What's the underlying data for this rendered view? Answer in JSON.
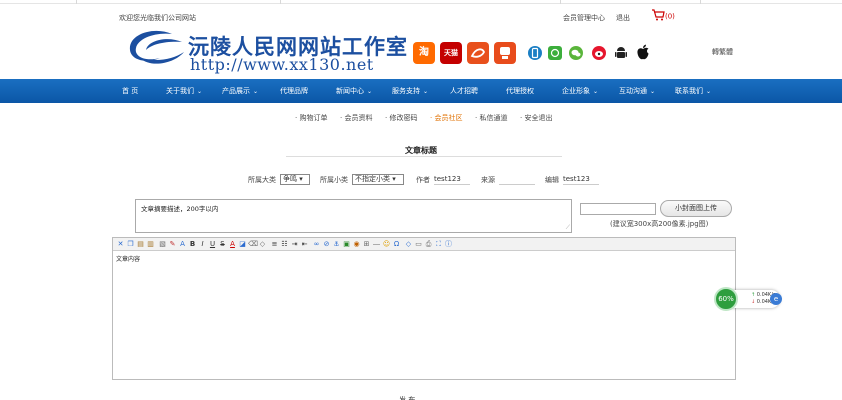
{
  "topbar": {
    "welcome": "欢迎您光临我们公司网站",
    "member_center": "会员管理中心",
    "logout": "退出",
    "cart_count": "(0)"
  },
  "logo": {
    "title": "沅陵人民网网站工作室",
    "url": "http://www.xx130.net"
  },
  "social_icons": [
    {
      "name": "taobao",
      "label": "淘",
      "color": "#ff6a00"
    },
    {
      "name": "tmall",
      "label": "天猫",
      "color": "#c40000"
    },
    {
      "name": "alipay",
      "label": "",
      "color": "#e8501c"
    },
    {
      "name": "weishop",
      "label": "",
      "color": "#e84c1c"
    }
  ],
  "right_icons": [
    {
      "name": "phone",
      "color": "#1b7fc4"
    },
    {
      "name": "message",
      "color": "#3cae3c"
    },
    {
      "name": "wechat",
      "color": "#5ab53b"
    },
    {
      "name": "weibo",
      "color": "#e6162d"
    },
    {
      "name": "android",
      "color": "#222222"
    },
    {
      "name": "apple",
      "color": "#222222"
    }
  ],
  "lang_toggle": "轉繁體",
  "nav": [
    {
      "label": "首 页",
      "caret": false
    },
    {
      "label": "关于我们",
      "caret": true
    },
    {
      "label": "产品展示",
      "caret": true
    },
    {
      "label": "代理品牌",
      "caret": false
    },
    {
      "label": "新闻中心",
      "caret": true
    },
    {
      "label": "服务支持",
      "caret": true
    },
    {
      "label": "人才招聘",
      "caret": false
    },
    {
      "label": "代理授权",
      "caret": false
    },
    {
      "label": "企业形象",
      "caret": true
    },
    {
      "label": "互动沟通",
      "caret": true
    },
    {
      "label": "联系我们",
      "caret": true
    }
  ],
  "subnav": [
    {
      "label": "购物订单",
      "active": false
    },
    {
      "label": "会员资料",
      "active": false
    },
    {
      "label": "修改密码",
      "active": false
    },
    {
      "label": "会员社区",
      "active": true
    },
    {
      "label": "私信通道",
      "active": false
    },
    {
      "label": "安全退出",
      "active": false
    }
  ],
  "form": {
    "heading": "文章标题",
    "category_label": "所属大类",
    "category_value": "争鸣",
    "subcategory_label": "所属小类",
    "subcategory_value": "不指定小类",
    "author_label": "作者",
    "author_value": "test123",
    "source_label": "来源",
    "source_value": "",
    "editor_label": "编辑",
    "editor_value": "test123",
    "summary_placeholder": "文章摘要描述，200字以内",
    "upload_button": "小封面图上传",
    "cover_hint": "(建议宽300x高200像素.jpg图)",
    "content_placeholder": "文章内容",
    "submit_label": "发 布"
  },
  "net_monitor": {
    "percent": "60%",
    "up_rate": "0.04K/s",
    "down_rate": "0.04K/s"
  }
}
